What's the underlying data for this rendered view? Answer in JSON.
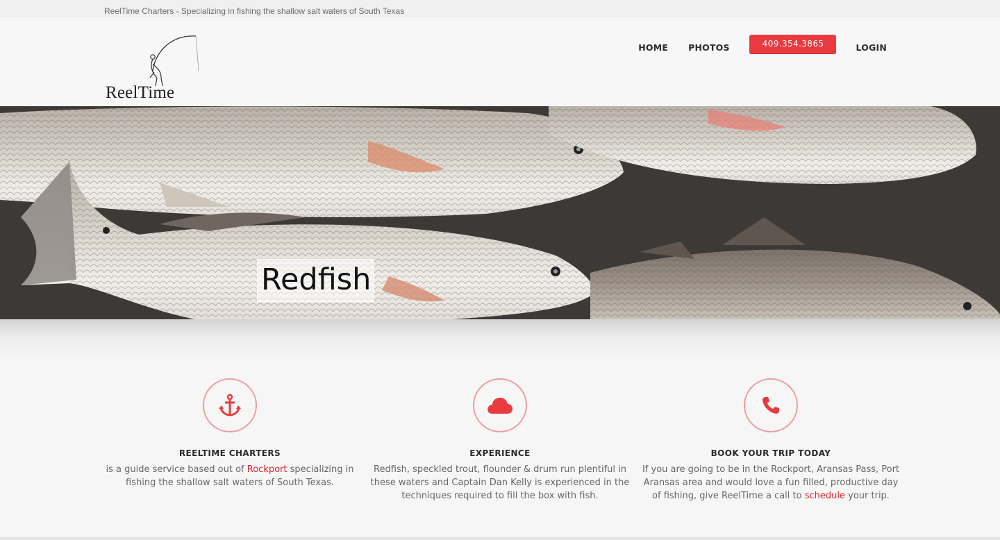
{
  "topbar": {
    "tagline": "ReelTime Charters - Specializing in fishing the shallow salt waters of South Texas"
  },
  "header": {
    "logo_text": "ReelTime",
    "logo_icon": "fisherman-casting-icon",
    "nav": {
      "home": "HOME",
      "photos": "PHOTOS",
      "phone": "409.354.3865",
      "login": "LOGIN"
    }
  },
  "hero": {
    "caption": "Redfish"
  },
  "features": [
    {
      "icon": "anchor-icon",
      "title": "REELTIME CHARTERS",
      "text_before": "is a guide service based out of ",
      "link": "Rockport",
      "text_after": " specializing in fishing the shallow salt waters of South Texas."
    },
    {
      "icon": "cloud-icon",
      "title": "EXPERIENCE",
      "text_before": "Redfish, speckled trout, flounder & drum run plentiful in these waters and Captain Dan Kelly is experienced in the techniques required to fill the box with fish.",
      "link": "",
      "text_after": ""
    },
    {
      "icon": "phone-icon",
      "title": "BOOK YOUR TRIP TODAY",
      "text_before": "If you are going to be in the Rockport, Aransas Pass, Port Aransas area and would love a fun filled, productive day of fishing, give ReelTime a call to ",
      "link": "schedule",
      "text_after": " your trip."
    }
  ],
  "colors": {
    "accent": "#e83a3f",
    "link": "#d9262e",
    "icon_ring": "#ee9da0",
    "heading": "#2a2a2a"
  }
}
